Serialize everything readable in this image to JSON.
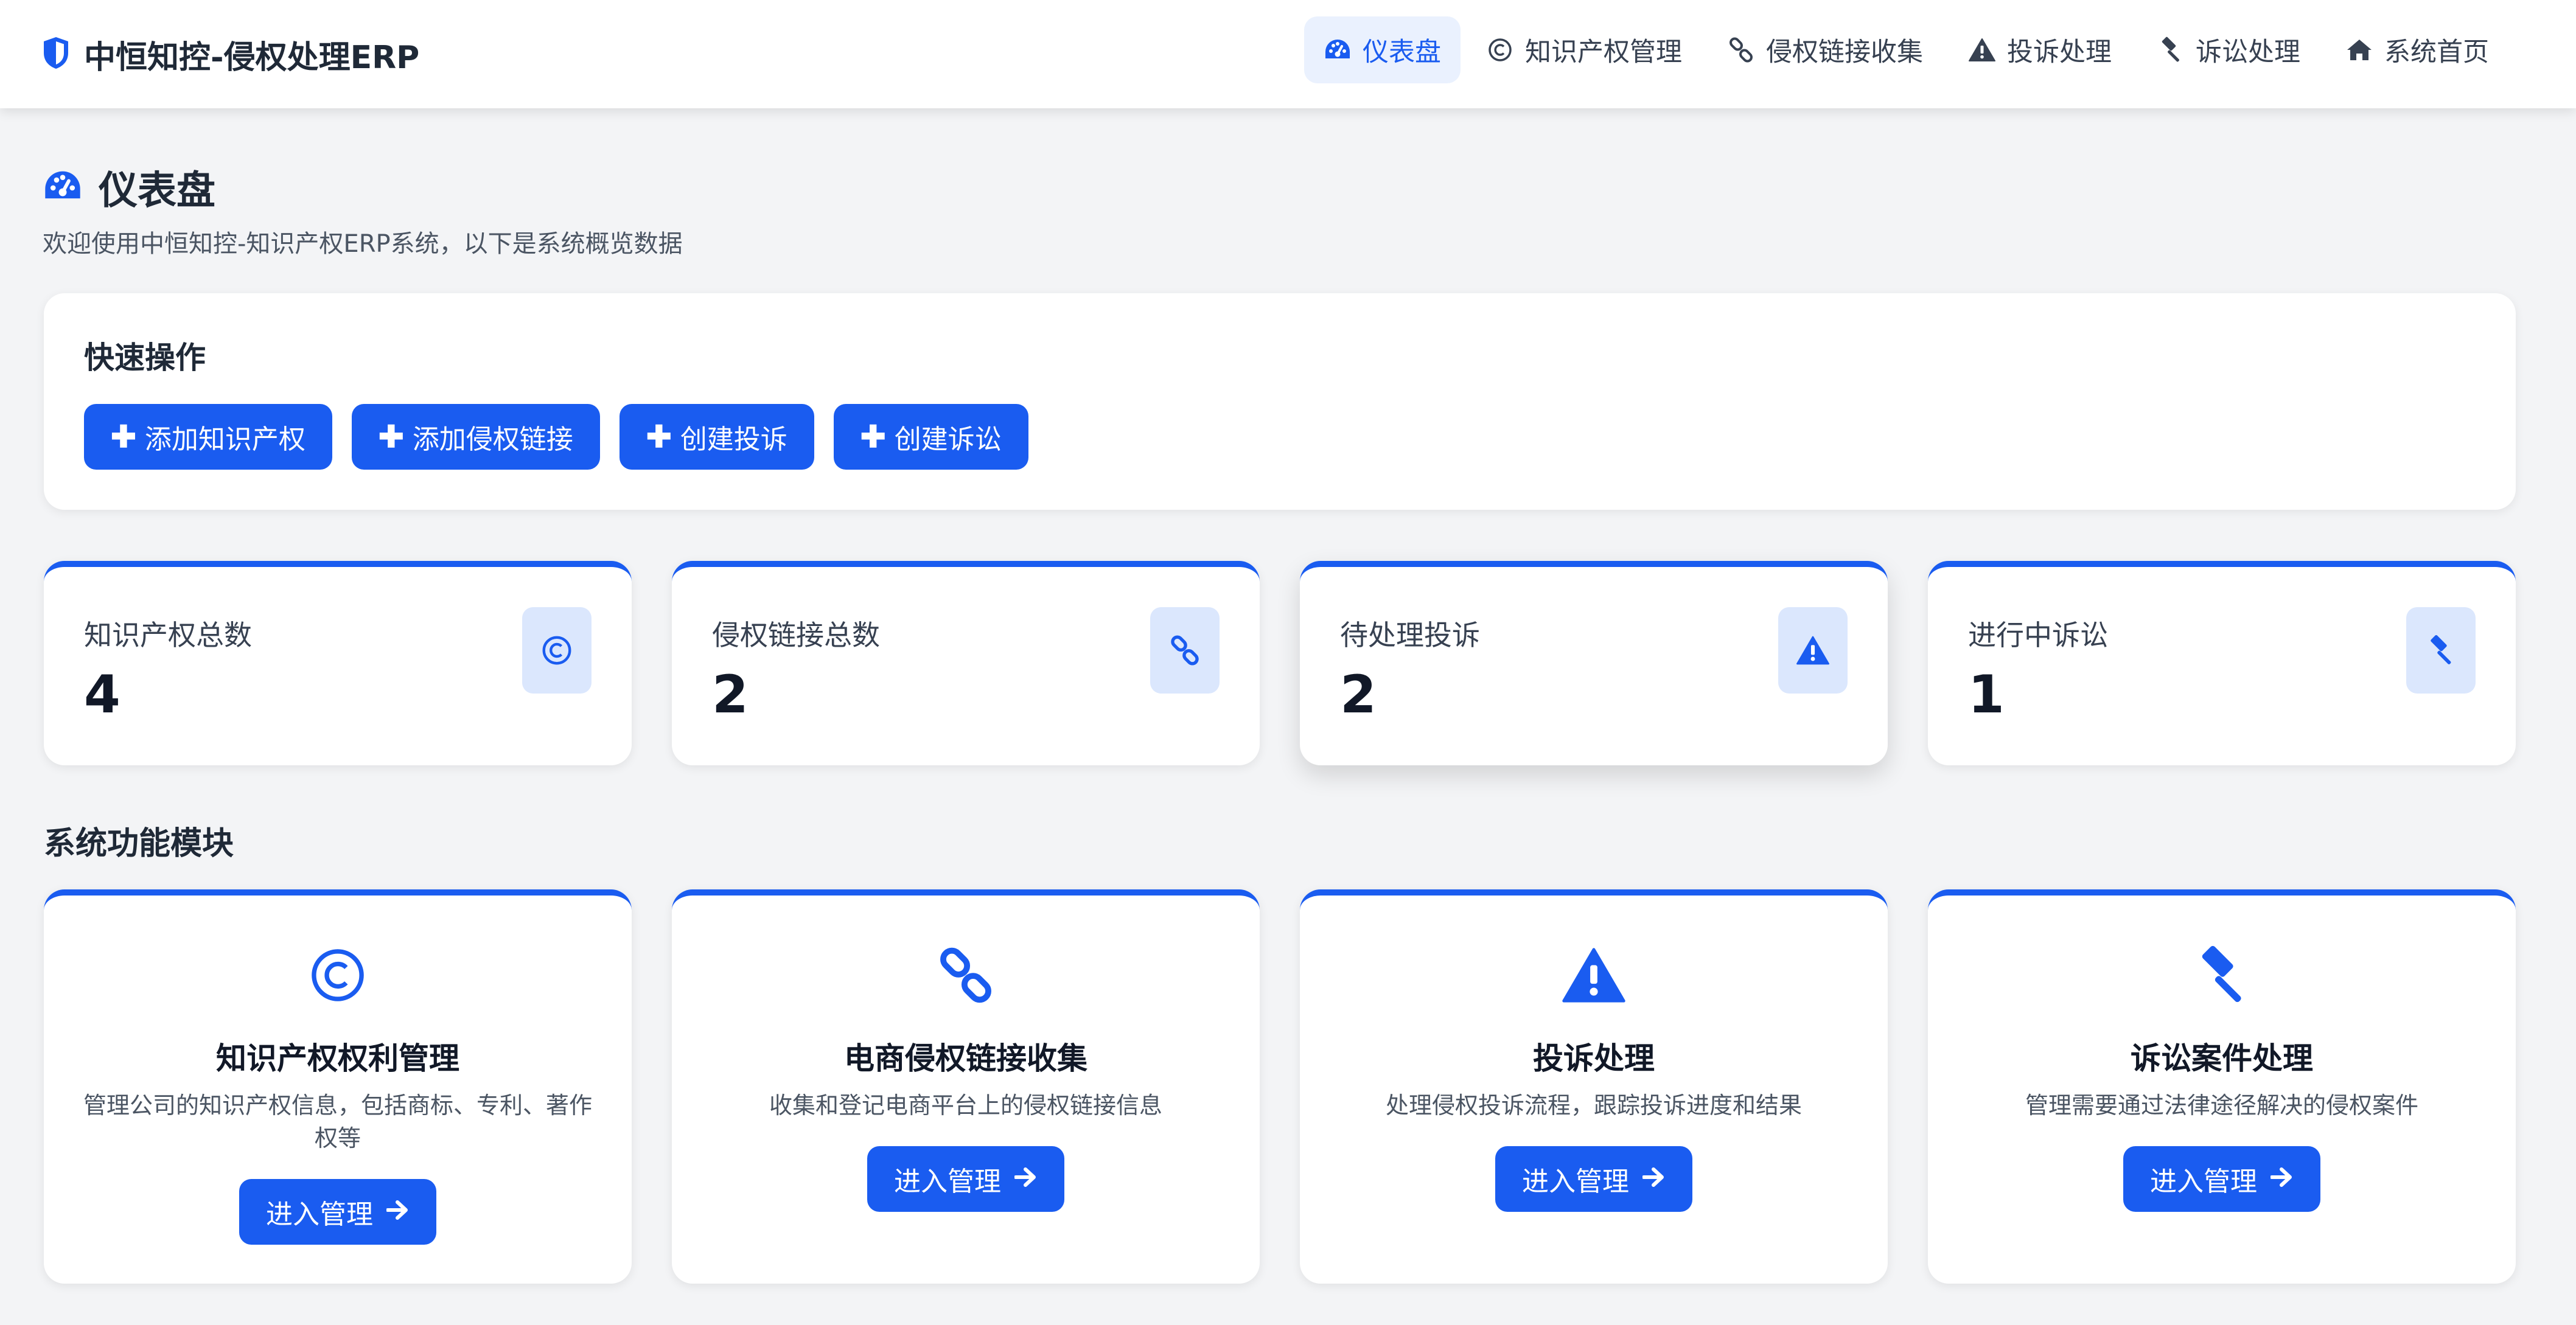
{
  "brand": {
    "title": "中恒知控-侵权处理ERP"
  },
  "nav": {
    "items": [
      {
        "label": "仪表盘",
        "icon": "dashboard-icon",
        "active": true
      },
      {
        "label": "知识产权管理",
        "icon": "copyright-icon"
      },
      {
        "label": "侵权链接收集",
        "icon": "link-icon"
      },
      {
        "label": "投诉处理",
        "icon": "warning-icon"
      },
      {
        "label": "诉讼处理",
        "icon": "gavel-icon"
      },
      {
        "label": "系统首页",
        "icon": "home-icon"
      }
    ]
  },
  "page": {
    "title": "仪表盘",
    "subtitle": "欢迎使用中恒知控-知识产权ERP系统，以下是系统概览数据"
  },
  "quick_actions": {
    "title": "快速操作",
    "buttons": [
      {
        "label": "添加知识产权"
      },
      {
        "label": "添加侵权链接"
      },
      {
        "label": "创建投诉"
      },
      {
        "label": "创建诉讼"
      }
    ]
  },
  "stats": [
    {
      "label": "知识产权总数",
      "value": "4",
      "icon": "copyright-icon"
    },
    {
      "label": "侵权链接总数",
      "value": "2",
      "icon": "link-icon"
    },
    {
      "label": "待处理投诉",
      "value": "2",
      "icon": "warning-icon"
    },
    {
      "label": "进行中诉讼",
      "value": "1",
      "icon": "gavel-icon"
    }
  ],
  "modules": {
    "title": "系统功能模块",
    "items": [
      {
        "title": "知识产权权利管理",
        "desc": "管理公司的知识产权信息，包括商标、专利、著作权等",
        "button": "进入管理",
        "icon": "copyright-icon"
      },
      {
        "title": "电商侵权链接收集",
        "desc": "收集和登记电商平台上的侵权链接信息",
        "button": "进入管理",
        "icon": "link-icon"
      },
      {
        "title": "投诉处理",
        "desc": "处理侵权投诉流程，跟踪投诉进度和结果",
        "button": "进入管理",
        "icon": "warning-icon"
      },
      {
        "title": "诉讼案件处理",
        "desc": "管理需要通过法律途径解决的侵权案件",
        "button": "进入管理",
        "icon": "gavel-icon"
      }
    ]
  },
  "colors": {
    "accent": "#1a5cf0",
    "accent_soft": "#dbe7fd",
    "nav_active_bg": "#eaf1fe",
    "page_bg": "#f3f4f6"
  }
}
